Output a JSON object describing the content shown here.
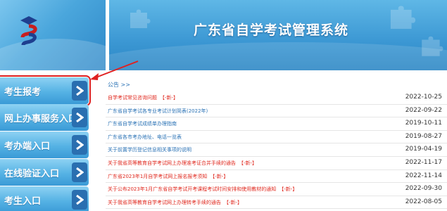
{
  "header": {
    "title": "广东省自学考试管理系统",
    "logo_icon": "exam-logo-icon"
  },
  "sidebar": {
    "items": [
      {
        "label": "考生报考",
        "highlighted": true
      },
      {
        "label": "网上办事服务入口"
      },
      {
        "label": "考办端入口"
      },
      {
        "label": "在线验证入口"
      },
      {
        "label": "考生入口"
      }
    ]
  },
  "main": {
    "section_label": "公告 >>",
    "news": [
      {
        "title": "自学考试常见咨询问题",
        "tag": "【-新-】",
        "date": "2022-10-25",
        "color": "red"
      },
      {
        "title": "广东省自学考试各专业考试计划简表(2022年)",
        "tag": "",
        "date": "2022-09-22",
        "color": "blue"
      },
      {
        "title": "广东省自学考试成绩单办理指南",
        "tag": "",
        "date": "2019-10-11",
        "color": "blue"
      },
      {
        "title": "广东省各市考办地址、电话一览表",
        "tag": "",
        "date": "2019-08-27",
        "color": "blue"
      },
      {
        "title": "关于前置学历登记信息相关事项的说明",
        "tag": "",
        "date": "2019-04-19",
        "color": "blue"
      },
      {
        "title": "关于我省高等教育自学考试网上办理准考证合并手续的通告",
        "tag": "【-新-】",
        "date": "2022-11-17",
        "color": "red"
      },
      {
        "title": "广东省2023年1月自学考试网上报名报考须知",
        "tag": "【-新-】",
        "date": "2022-11-14",
        "color": "red"
      },
      {
        "title": "关于公布2023年1月广东省自学考试开考课程考试时间安排和使用教材的通知",
        "tag": "【-新-】",
        "date": "2022-09-30",
        "color": "red"
      },
      {
        "title": "关于我省高等教育自学考试网上办理转考手续的通告",
        "tag": "【-新-】",
        "date": "2022-08-05",
        "color": "red"
      }
    ]
  },
  "colors": {
    "accent_blue": "#3a9ad6",
    "link_blue": "#2a72b5",
    "alert_red": "#e0281e",
    "arrow_button": "#2a6fb0"
  },
  "icons": [
    "exam-logo-icon",
    "chevron-right-icon",
    "puzzle-decoration",
    "annotation-arrow"
  ]
}
